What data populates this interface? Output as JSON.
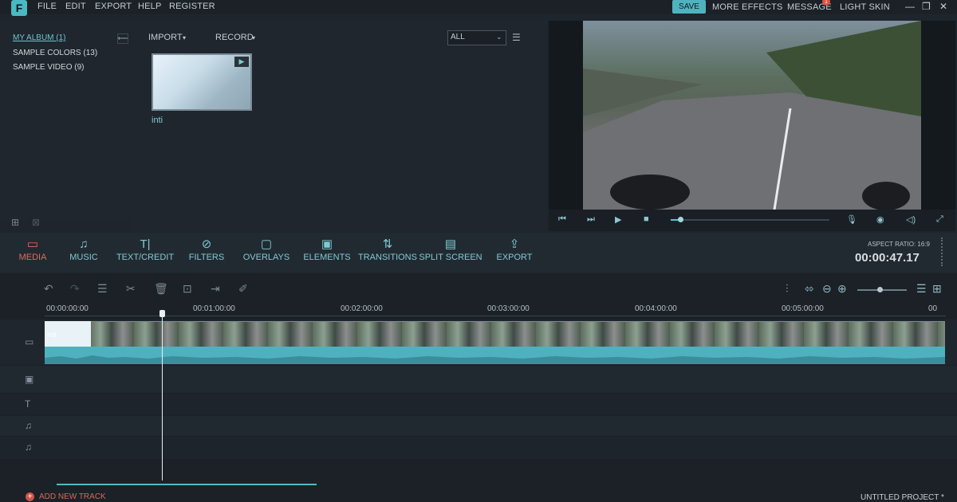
{
  "menu": {
    "logo": "F",
    "file": "FILE",
    "edit": "EDIT",
    "export": "EXPORT",
    "help": "HELP",
    "register": "REGISTER",
    "save": "SAVE",
    "more_effects": "MORE EFFECTS",
    "message": "MESSAGE",
    "message_badge": "1",
    "light_skin": "LIGHT SKIN"
  },
  "albums": [
    "MY ALBUM (1)",
    "SAMPLE COLORS (13)",
    "SAMPLE VIDEO (9)"
  ],
  "media": {
    "import": "IMPORT",
    "record": "RECORD",
    "filter": "ALL",
    "item_name": "inti"
  },
  "tools": [
    {
      "label": "MEDIA",
      "icon": "folder-icon"
    },
    {
      "label": "MUSIC",
      "icon": "music-icon"
    },
    {
      "label": "TEXT/CREDIT",
      "icon": "text-icon"
    },
    {
      "label": "FILTERS",
      "icon": "filter-icon"
    },
    {
      "label": "OVERLAYS",
      "icon": "overlay-icon"
    },
    {
      "label": "ELEMENTS",
      "icon": "image-icon"
    },
    {
      "label": "TRANSITIONS",
      "icon": "transition-icon"
    },
    {
      "label": "SPLIT SCREEN",
      "icon": "split-icon"
    },
    {
      "label": "EXPORT",
      "icon": "export-icon"
    }
  ],
  "aspect_ratio": "ASPECT RATIO: 16:9",
  "timecode": "00:00:47.17",
  "ruler": [
    "00:00:00:00",
    "00:01:00:00",
    "00:02:00:00",
    "00:03:00:00",
    "00:04:00:00",
    "00:05:00:00",
    "00"
  ],
  "clip_label": "inti",
  "add_new_track": "ADD NEW TRACK",
  "project": "UNTITLED PROJECT *",
  "colors": {
    "accent": "#4fb3bf",
    "active": "#e06a5a"
  }
}
